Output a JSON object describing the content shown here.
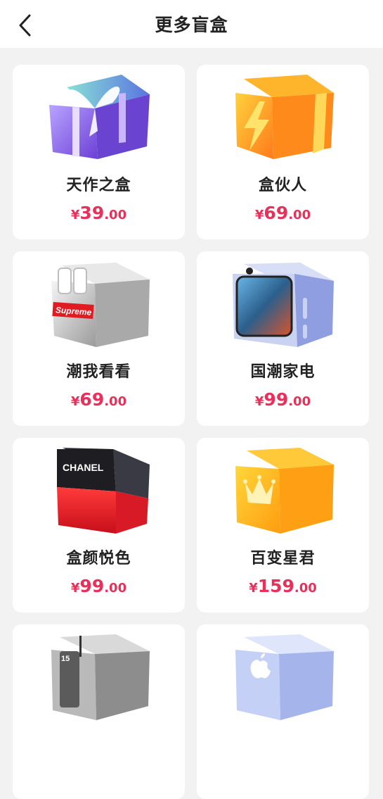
{
  "header": {
    "title": "更多盲盒",
    "back_icon": "chevron-left-icon"
  },
  "colors": {
    "accent": "#e8305a",
    "background": "#f2f2f2",
    "card": "#ffffff"
  },
  "products": [
    {
      "name": "天作之盒",
      "currency": "¥",
      "price_int": "39",
      "price_dec": ".00",
      "icon": "gift-box-icon"
    },
    {
      "name": "盒伙人",
      "currency": "¥",
      "price_int": "69",
      "price_dec": ".00",
      "icon": "lightning-box-icon"
    },
    {
      "name": "潮我看看",
      "currency": "¥",
      "price_int": "69",
      "price_dec": ".00",
      "icon": "supreme-box-icon",
      "image_text": "Supreme"
    },
    {
      "name": "国潮家电",
      "currency": "¥",
      "price_int": "99",
      "price_dec": ".00",
      "icon": "appliance-box-icon"
    },
    {
      "name": "盒颜悦色",
      "currency": "¥",
      "price_int": "99",
      "price_dec": ".00",
      "icon": "chanel-box-icon",
      "image_text": "CHANEL"
    },
    {
      "name": "百变星君",
      "currency": "¥",
      "price_int": "159",
      "price_dec": ".00",
      "icon": "crown-box-icon"
    },
    {
      "name": "",
      "currency": "",
      "price_int": "",
      "price_dec": "",
      "icon": "phone-box-icon",
      "image_text": "15"
    },
    {
      "name": "",
      "currency": "",
      "price_int": "",
      "price_dec": "",
      "icon": "apple-box-icon"
    }
  ]
}
